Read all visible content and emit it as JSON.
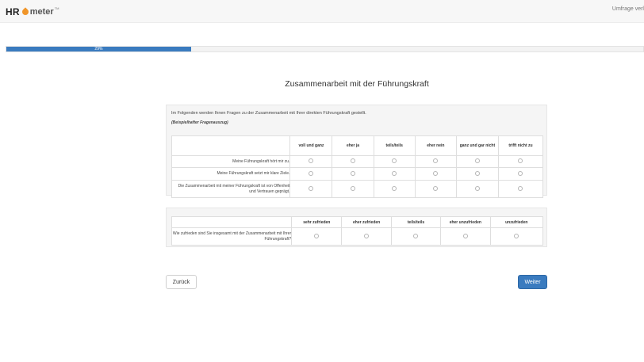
{
  "header": {
    "logo_hr": "HR",
    "logo_meter": "meter",
    "logo_tm": "TM",
    "top_right_text": "Umfrage verl",
    "accent_color": "#f0962a"
  },
  "progress": {
    "value_percent": 29,
    "label": "29%"
  },
  "question": {
    "title": "Zusammenarbeit mit der Führungskraft"
  },
  "matrix1": {
    "intro": "Im Folgenden werden Ihnen Fragen zu der Zusammenarbeit mit Ihrer direkten Führungskraft gestellt.",
    "note": "(Beispielhafter Fragenauszug)",
    "columns": [
      "voll und ganz",
      "eher ja",
      "teils/teils",
      "eher nein",
      "ganz und gar nicht",
      "trifft nicht zu"
    ],
    "rows": [
      "Meine Führungskraft hört mir zu.",
      "Meine Führungskraft setzt mir klare Ziele.",
      "Die Zusammenarbeit mit meiner Führungskraft ist von Offenheit und Vertrauen geprägt."
    ]
  },
  "matrix2": {
    "columns": [
      "sehr zufrieden",
      "eher zufrieden",
      "teils/teils",
      "eher unzufrieden",
      "unzufrieden"
    ],
    "rows": [
      "Wie zufrieden sind Sie insgesamt mit der Zusammenarbeit mit Ihrer Führungskraft?"
    ]
  },
  "nav": {
    "back_label": "Zurück",
    "next_label": "Weiter",
    "primary_color": "#3a7bbf"
  }
}
